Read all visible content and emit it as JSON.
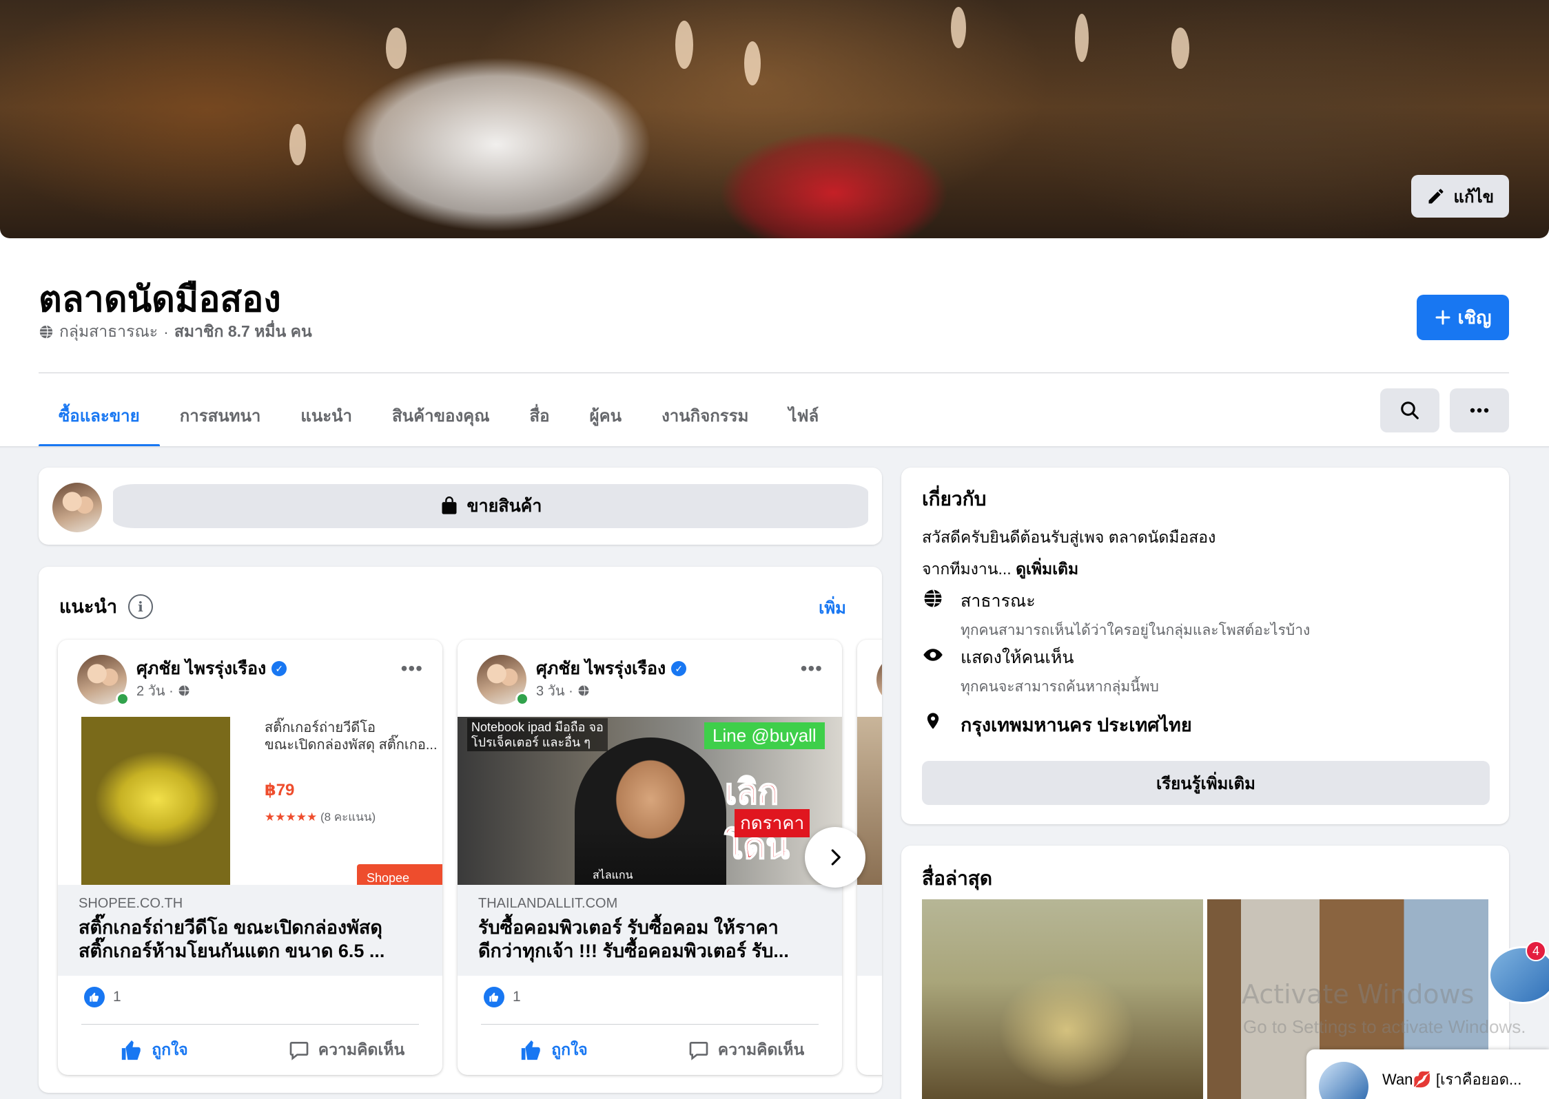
{
  "cover": {
    "edit_label": "แก้ไข"
  },
  "group": {
    "name": "ตลาดนัดมือสอง",
    "privacy": "กลุ่มสาธารณะ",
    "separator": "·",
    "members": "สมาชิก 8.7 หมื่น คน",
    "invite_label": "เชิญ"
  },
  "tabs": [
    {
      "label": "ซื้อและขาย",
      "active": true
    },
    {
      "label": "การสนทนา"
    },
    {
      "label": "แนะนำ"
    },
    {
      "label": "สินค้าของคุณ"
    },
    {
      "label": "สื่อ"
    },
    {
      "label": "ผู้คน"
    },
    {
      "label": "งานกิจกรรม"
    },
    {
      "label": "ไฟล์"
    }
  ],
  "sell": {
    "label": "ขายสินค้า"
  },
  "featured": {
    "title": "แนะนำ",
    "info_glyph": "i",
    "see_more": "เพิ่ม",
    "posts": [
      {
        "author": "ศุภชัย ไพรรุ่งเรือง",
        "time": "2 วัน ·",
        "domain": "SHOPEE.CO.TH",
        "title_line1": "สติ๊กเกอร์ถ่ายวีดีโอ ขณะเปิดกล่องพัสดุ",
        "title_line2": "สติ๊กเกอร์ห้ามโยนกันแตก ขนาด 6.5 ...",
        "media_caption1": "สติ๊กเกอร์ถ่ายวีดีโอ",
        "media_caption2": "ขณะเปิดกล่องพัสดุ สติ๊กเกอ...",
        "price": "฿79",
        "rating": "★★★★★",
        "rating_count": "(8 คะแนน)",
        "shop_badge": "Shopee",
        "likes": "1",
        "like_label": "ถูกใจ",
        "comment_label": "ความคิดเห็น"
      },
      {
        "author": "ศุภชัย ไพรรุ่งเรือง",
        "time": "3 วัน ·",
        "domain": "THAILANDALLIT.COM",
        "title_line1": "รับซื้อคอมพิวเตอร์ รับซื้อคอม ให้ราคา",
        "title_line2": "ดีกว่าทุกเจ้า !!! รับซื้อคอมพิวเตอร์ รับ...",
        "media_top_text1": "Notebook ipad มือถือ จอ",
        "media_top_text2": "โปรเจ็คเตอร์ และอื่น ๆ",
        "media_line_tag": "Line @buyall",
        "media_big_text": "เลิกโดน",
        "media_sub_text": "กดราคา",
        "media_bottom_text": "สไลแกน",
        "likes": "1",
        "like_label": "ถูกใจ",
        "comment_label": "ความคิดเห็น"
      }
    ]
  },
  "about": {
    "title": "เกี่ยวกับ",
    "desc": "สวัสดีครับยินดีต้อนรับสู่เพจ ตลาดนัดมือสอง",
    "from_team": "จากทีมงาน...",
    "see_more": "ดูเพิ่มเติม",
    "public_title": "สาธารณะ",
    "public_desc": "ทุกคนสามารถเห็นได้ว่าใครอยู่ในกลุ่มและโพสต์อะไรบ้าง",
    "visible_title": "แสดงให้คนเห็น",
    "visible_desc": "ทุกคนจะสามารถค้นหากลุ่มนี้พบ",
    "location": "กรุงเทพมหานคร ประเทศไทย",
    "learn_more": "เรียนรู้เพิ่มเติม"
  },
  "media": {
    "title": "สื่อล่าสุด"
  },
  "watermark": {
    "line1": "Activate Windows",
    "line2": "Go to Settings to activate Windows."
  },
  "chat": {
    "badge": "4",
    "popup_name": "Wan💋 [เราคือยอด..."
  },
  "colors": {
    "accent": "#1877f2",
    "background": "#f0f2f5",
    "button_gray": "#e4e6eb",
    "online": "#31a24c"
  }
}
